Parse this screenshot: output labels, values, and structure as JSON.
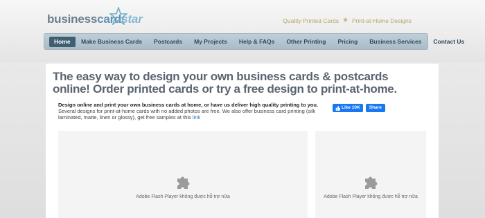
{
  "logo": {
    "part1": "business",
    "part2": "card",
    "part3": "star"
  },
  "tagline": {
    "left": "Quality Printed Cards",
    "right": "Print-at-Home Designs"
  },
  "nav": {
    "items": [
      {
        "label": "Home"
      },
      {
        "label": "Make Business Cards"
      },
      {
        "label": "Postcards"
      },
      {
        "label": "My Projects"
      },
      {
        "label": "Help & FAQs"
      },
      {
        "label": "Other Printing"
      },
      {
        "label": "Pricing"
      },
      {
        "label": "Business Services"
      },
      {
        "label": "Contact Us"
      }
    ]
  },
  "main": {
    "headline": "The easy way to design your own business cards & postcards online! Order printed cards or try a free design to print-at-home.",
    "intro_bold": "Design online and print your own business cards at home, or have us deliver high quality printing to you.",
    "intro_text": "Several designs for print-at-home cards with no added photos are free. We also offer business card printing (silk laminated, matte, linen or glossy), get free samples at this",
    "intro_link": "link"
  },
  "social": {
    "like_label": "Like 10K",
    "share_label": "Share"
  },
  "flash": {
    "message": "Adobe Flash Player không được hỗ trợ nữa"
  },
  "colors": {
    "accent": "#3f5e6f",
    "nav_bg": "#b5c6d1",
    "link": "#2e6fb5",
    "facebook": "#1877f2"
  }
}
